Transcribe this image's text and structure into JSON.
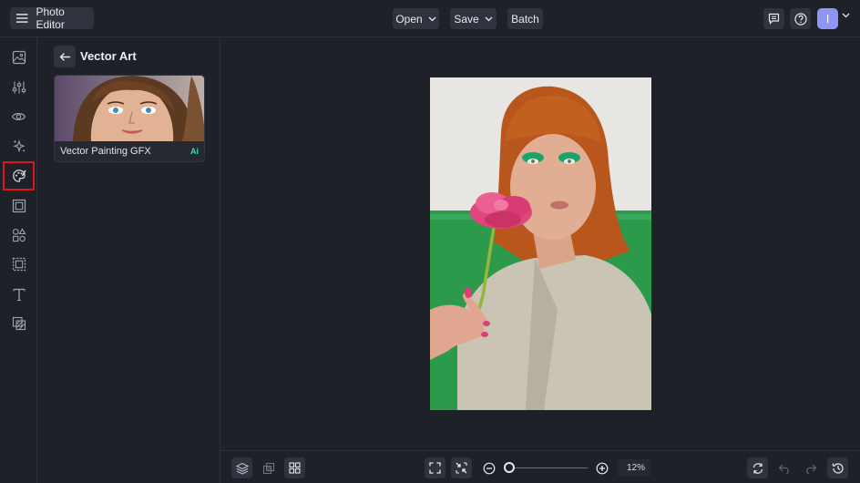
{
  "app": {
    "title": "Photo Editor",
    "menu_icon": "hamburger-icon"
  },
  "toolbar": {
    "open_label": "Open",
    "save_label": "Save",
    "batch_label": "Batch",
    "feedback_icon": "chat-icon",
    "help_icon": "help-icon",
    "avatar_initial": "I"
  },
  "rail": {
    "items": [
      {
        "id": "image",
        "icon": "image-icon"
      },
      {
        "id": "adjust",
        "icon": "sliders-icon"
      },
      {
        "id": "effects",
        "icon": "eye-icon"
      },
      {
        "id": "ai",
        "icon": "sparkle-icon"
      },
      {
        "id": "artsy",
        "icon": "palette-icon",
        "active": true
      },
      {
        "id": "frames",
        "icon": "frame-icon"
      },
      {
        "id": "graphics",
        "icon": "shapes-icon"
      },
      {
        "id": "overlays",
        "icon": "overlay-icon"
      },
      {
        "id": "text",
        "icon": "text-icon"
      },
      {
        "id": "layers",
        "icon": "layers-copy-icon"
      }
    ]
  },
  "panel": {
    "title": "Vector Art",
    "cards": [
      {
        "label": "Vector Painting GFX",
        "badge": "Ai"
      }
    ]
  },
  "zoom": {
    "readout": "12%",
    "level": 0.12
  },
  "colors": {
    "background": "#1f2129",
    "button": "#30333d",
    "accent": "#8e95f5",
    "active_outline": "#e0141c",
    "ai_badge": "#3fd7a8"
  }
}
